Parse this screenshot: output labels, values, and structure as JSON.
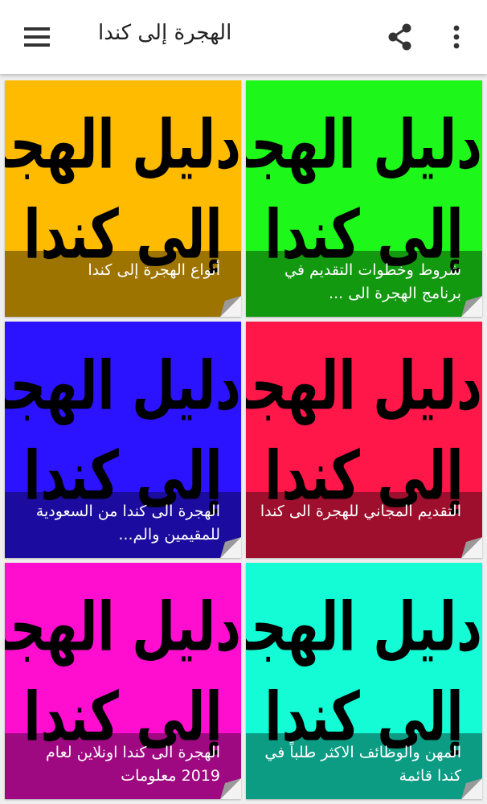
{
  "appbar": {
    "title": "الهجرة إلى كندا",
    "menu_icon": "hamburger-menu-icon",
    "share_icon": "share-icon",
    "more_icon": "more-vert-icon"
  },
  "cards": [
    {
      "art_line1": "دليل الهجرة",
      "art_line2": "إلى كندا",
      "caption": "شروط وخطوات التقديم في برنامج الهجرة الى ...",
      "color": "#1df71a"
    },
    {
      "art_line1": "دليل الهجرة",
      "art_line2": "إلى كندا",
      "caption": "أنواع الهجرة إلى كندا",
      "color": "#ffbb00"
    },
    {
      "art_line1": "دليل الهجرة",
      "art_line2": "إلى كندا",
      "caption": "التقديم المجاني للهجرة الى كندا",
      "color": "#ff1749"
    },
    {
      "art_line1": "دليل الهجرة",
      "art_line2": "إلى كندا",
      "caption": "الهجرة الى كندا من السعودية للمقيمين والم...",
      "color": "#2c13ff"
    },
    {
      "art_line1": "دليل الهجرة",
      "art_line2": "إلى كندا",
      "caption": "المهن والوظائف الاكثر طلباً في كندا قائمة",
      "color": "#14fcd5"
    },
    {
      "art_line1": "دليل الهجرة",
      "art_line2": "إلى كندا",
      "caption": "الهجرة الى كندا اونلاين لعام 2019 معلومات",
      "color": "#ff0ed0"
    }
  ]
}
